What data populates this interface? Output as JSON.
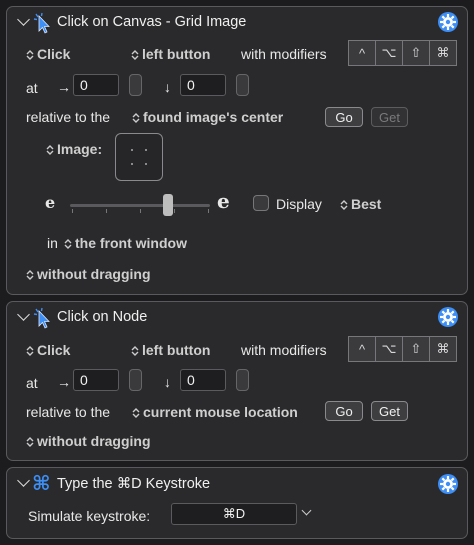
{
  "actions": [
    {
      "title": "Click on Canvas - Grid Image",
      "click_type": "Click",
      "button": "left button",
      "with_modifiers": "with modifiers",
      "modifiers": [
        "^",
        "⌥",
        "⇧",
        "⌘"
      ],
      "at_label": "at",
      "x_arrow": "→",
      "x_value": "0",
      "y_arrow": "↓",
      "y_value": "0",
      "relative_label": "relative to the",
      "relative_value": "found image's center",
      "go_label": "Go",
      "get_label": "Get",
      "image_label": "Image:",
      "slider_level": 0.6,
      "display_label": "Display",
      "quality": "Best",
      "in_label": "in",
      "window_value": "the front window",
      "drag_value": "without dragging"
    },
    {
      "title": "Click on Node",
      "click_type": "Click",
      "button": "left button",
      "with_modifiers": "with modifiers",
      "modifiers": [
        "^",
        "⌥",
        "⇧",
        "⌘"
      ],
      "at_label": "at",
      "x_arrow": "→",
      "x_value": "0",
      "y_arrow": "↓",
      "y_value": "0",
      "relative_label": "relative to the",
      "relative_value": "current mouse location",
      "go_label": "Go",
      "get_label": "Get",
      "drag_value": "without dragging"
    },
    {
      "title": "Type the ⌘D Keystroke",
      "simulate_label": "Simulate keystroke:",
      "keystroke": "⌘D"
    }
  ],
  "colors": {
    "panel": "#2a2a2c",
    "border": "#5a5a5e",
    "gear_blue": "#3d8ef5",
    "bg": "#1c1c1e"
  }
}
